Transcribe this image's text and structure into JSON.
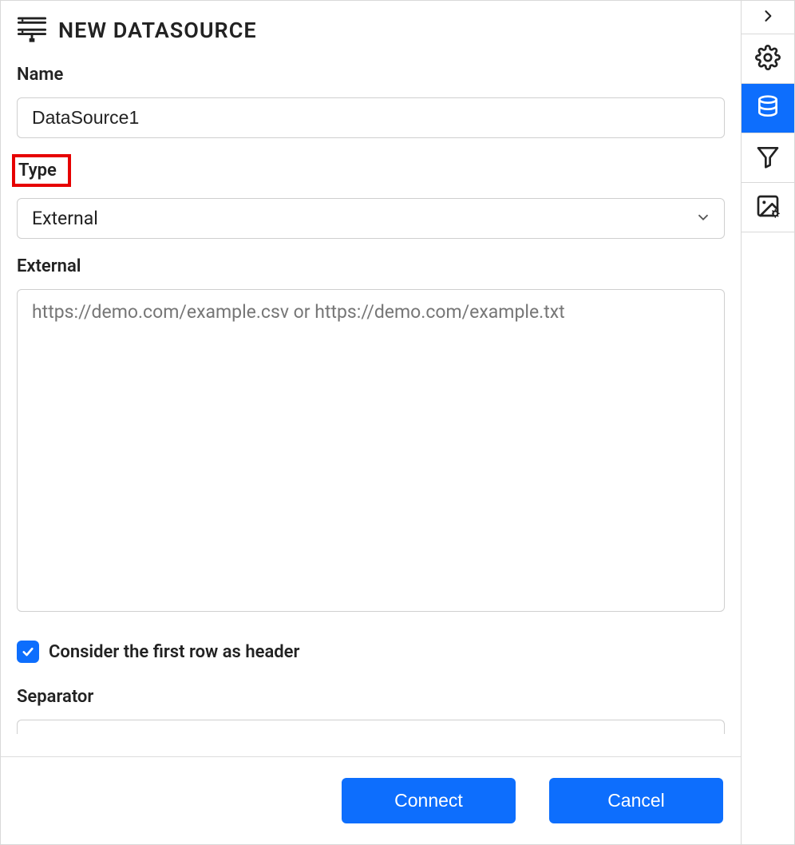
{
  "header": {
    "title": "NEW DATASOURCE"
  },
  "fields": {
    "name": {
      "label": "Name",
      "value": "DataSource1"
    },
    "type": {
      "label": "Type",
      "value": "External",
      "highlighted": true
    },
    "external": {
      "label": "External",
      "value": "",
      "placeholder": "https://demo.com/example.csv or https://demo.com/example.txt"
    },
    "header_row": {
      "label": "Consider the first row as header",
      "checked": true
    },
    "separator": {
      "label": "Separator",
      "value": ""
    }
  },
  "footer": {
    "connect_label": "Connect",
    "cancel_label": "Cancel"
  },
  "sidebar": {
    "items": [
      {
        "name": "collapse",
        "icon": "chevron-right",
        "active": false
      },
      {
        "name": "settings",
        "icon": "gear",
        "active": false
      },
      {
        "name": "datasource",
        "icon": "database",
        "active": true
      },
      {
        "name": "filter",
        "icon": "funnel",
        "active": false
      },
      {
        "name": "image-settings",
        "icon": "image-gear",
        "active": false
      }
    ]
  },
  "colors": {
    "primary": "#0d6efd",
    "highlight_border": "#e60000"
  }
}
